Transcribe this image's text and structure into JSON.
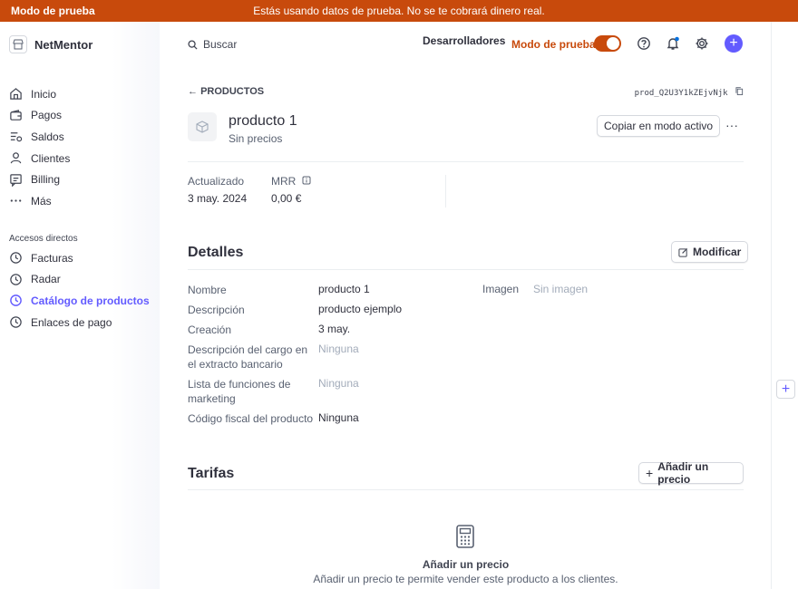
{
  "banner": {
    "mode_label": "Modo de prueba",
    "message": "Estás usando datos de prueba. No se te cobrará dinero real."
  },
  "brand": {
    "name": "NetMentor",
    "icon": "store-icon"
  },
  "search": {
    "placeholder": "Buscar"
  },
  "topbar": {
    "developers": "Desarrolladores",
    "test_mode": "Modo de prueba",
    "icons": [
      "help-icon",
      "bell-icon",
      "gear-icon",
      "plus-icon"
    ]
  },
  "sidebar": {
    "items": [
      {
        "label": "Inicio",
        "icon": "home-icon"
      },
      {
        "label": "Pagos",
        "icon": "wallet-icon"
      },
      {
        "label": "Saldos",
        "icon": "balance-icon"
      },
      {
        "label": "Clientes",
        "icon": "user-icon"
      },
      {
        "label": "Billing",
        "icon": "billing-icon"
      },
      {
        "label": "Más",
        "icon": "more-icon"
      }
    ],
    "shortcuts_label": "Accesos directos",
    "shortcuts": [
      {
        "label": "Facturas",
        "icon": "clock-icon"
      },
      {
        "label": "Radar",
        "icon": "clock-icon"
      },
      {
        "label": "Catálogo de productos",
        "icon": "clock-icon",
        "active": true
      },
      {
        "label": "Enlaces de pago",
        "icon": "clock-icon"
      }
    ]
  },
  "product": {
    "back_label": "PRODUCTOS",
    "id": "prod_Q2U3Y1kZEjvNjk",
    "name": "producto 1",
    "subtitle": "Sin precios",
    "copy_button": "Copiar en modo activo",
    "more": "···",
    "updated_label": "Actualizado",
    "updated_value": "3 may. 2024",
    "mrr_label": "MRR",
    "mrr_value": "0,00 €"
  },
  "details": {
    "title": "Detalles",
    "edit_button": "Modificar",
    "rows": [
      {
        "label": "Nombre",
        "value": "producto 1"
      },
      {
        "label": "Descripción",
        "value": "producto ejemplo"
      },
      {
        "label": "Creación",
        "value": "3 may."
      },
      {
        "label": "Descripción del cargo en el extracto bancario",
        "value": "Ninguna"
      },
      {
        "label": "Lista de funciones de marketing",
        "value": "Ninguna"
      },
      {
        "label": "Código fiscal del producto",
        "value": "Ninguna"
      }
    ],
    "image_label": "Imagen",
    "image_value": "Sin imagen"
  },
  "pricing": {
    "title": "Tarifas",
    "add_button": "Añadir un precio",
    "empty_title": "Añadir un precio",
    "empty_desc": "Añadir un precio te permite vender este producto a los clientes."
  },
  "colors": {
    "accent": "#635bff",
    "test_mode": "#c84a0c"
  }
}
